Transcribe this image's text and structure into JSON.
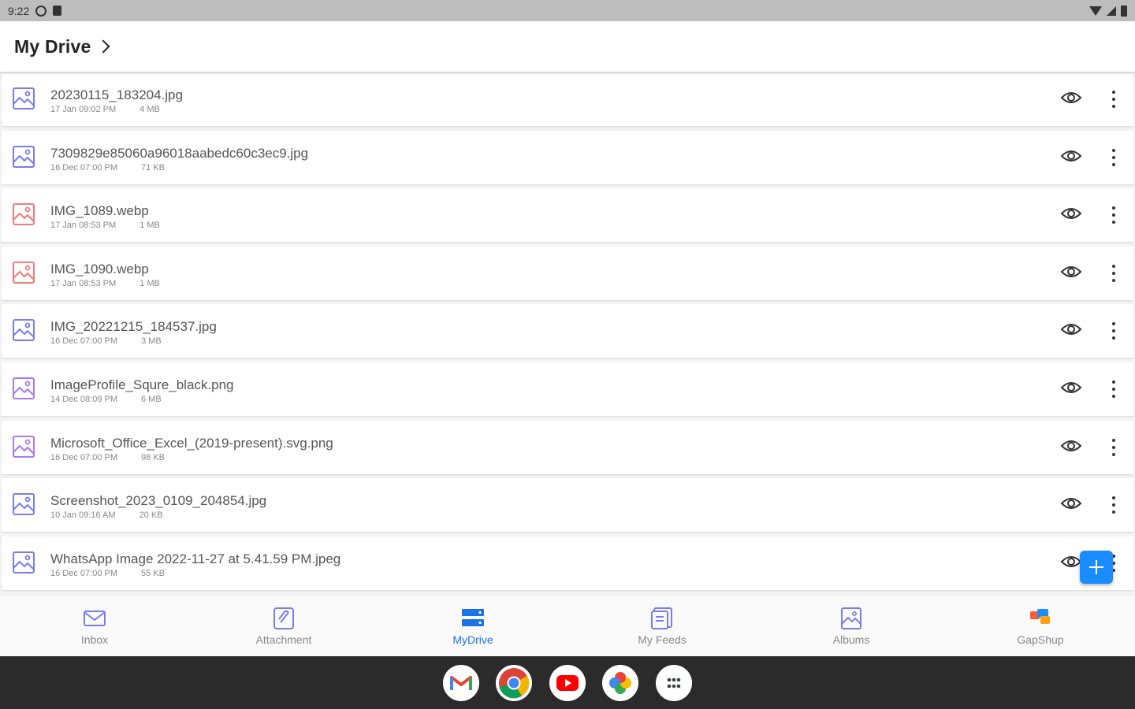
{
  "status_bar": {
    "time": "9:22",
    "icons": [
      "settings-icon",
      "sd-card-icon",
      "wifi-icon",
      "signal-icon",
      "battery-icon"
    ]
  },
  "header": {
    "title": "My Drive",
    "chevron_icon": "chevron-right-icon"
  },
  "files": [
    {
      "name": "20230115_183204.jpg",
      "date": "17 Jan 09:02 PM",
      "size": "4  MB",
      "icon": "image-file-icon",
      "icon_color": "#7b7bf0"
    },
    {
      "name": "7309829e85060a96018aabedc60c3ec9.jpg",
      "date": "16 Dec 07:00 PM",
      "size": "71  KB",
      "icon": "image-file-icon",
      "icon_color": "#7b7bf0"
    },
    {
      "name": "IMG_1089.webp",
      "date": "17 Jan 08:53 PM",
      "size": "1  MB",
      "icon": "image-file-icon",
      "icon_color": "#f07b7b"
    },
    {
      "name": "IMG_1090.webp",
      "date": "17 Jan 08:53 PM",
      "size": "1  MB",
      "icon": "image-file-icon",
      "icon_color": "#f07b7b"
    },
    {
      "name": "IMG_20221215_184537.jpg",
      "date": "16 Dec 07:00 PM",
      "size": "3  MB",
      "icon": "image-file-icon",
      "icon_color": "#7b7bf0"
    },
    {
      "name": "ImageProfile_Squre_black.png",
      "date": "14 Dec 08:09 PM",
      "size": "6  MB",
      "icon": "image-file-icon",
      "icon_color": "#a87bf0"
    },
    {
      "name": "Microsoft_Office_Excel_(2019-present).svg.png",
      "date": "16 Dec 07:00 PM",
      "size": "98  KB",
      "icon": "image-file-icon",
      "icon_color": "#a87bf0"
    },
    {
      "name": "Screenshot_2023_0109_204854.jpg",
      "date": "10 Jan 09:16 AM",
      "size": "20  KB",
      "icon": "image-file-icon",
      "icon_color": "#7b7bf0"
    },
    {
      "name": "WhatsApp Image 2022-11-27 at 5.41.59 PM.jpeg",
      "date": "16 Dec 07:00 PM",
      "size": "55  KB",
      "icon": "image-file-icon",
      "icon_color": "#7b7bf0"
    }
  ],
  "fab": {
    "icon": "plus-icon",
    "color": "#1a8cff"
  },
  "bottom_nav": [
    {
      "label": "Inbox",
      "icon": "mail-icon",
      "active": false
    },
    {
      "label": "Attachment",
      "icon": "attachment-icon",
      "active": false
    },
    {
      "label": "MyDrive",
      "icon": "drive-icon",
      "active": true
    },
    {
      "label": "My Feeds",
      "icon": "feeds-icon",
      "active": false
    },
    {
      "label": "Albums",
      "icon": "albums-icon",
      "active": false
    },
    {
      "label": "GapShup",
      "icon": "gapshup-icon",
      "active": false
    }
  ],
  "dock_apps": [
    "gmail-icon",
    "chrome-icon",
    "youtube-icon",
    "photos-icon",
    "app-drawer-icon"
  ],
  "colors": {
    "accent": "#1a73e8",
    "status_bar": "#bdbdbd",
    "dock": "#2b2b2b"
  }
}
